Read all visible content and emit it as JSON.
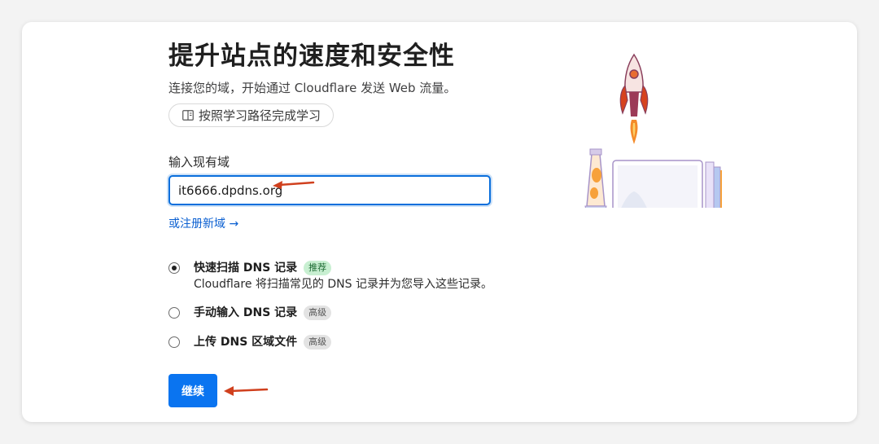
{
  "page": {
    "title": "提升站点的速度和安全性",
    "subtitle": "连接您的域，开始通过 Cloudflare 发送 Web 流量。",
    "learn_button": "按照学习路径完成学习"
  },
  "domain_field": {
    "label": "输入现有域",
    "value": "it6666.dpdns.org"
  },
  "register_link": "或注册新域 →",
  "options": [
    {
      "title": "快速扫描 DNS 记录",
      "badge": "推荐",
      "description": "Cloudflare 将扫描常见的 DNS 记录并为您导入这些记录。",
      "checked": true
    },
    {
      "title": "手动输入 DNS 记录",
      "badge": "高级",
      "checked": false
    },
    {
      "title": "上传 DNS 区域文件",
      "badge": "高级",
      "checked": false
    }
  ],
  "continue_button": "继续",
  "colors": {
    "primary": "#0a74f0",
    "annotation_arrow": "#d0401e",
    "badge_green_bg": "#c8efd1"
  },
  "icons": [
    "book-icon",
    "rocket-illustration",
    "annotation-arrow"
  ]
}
